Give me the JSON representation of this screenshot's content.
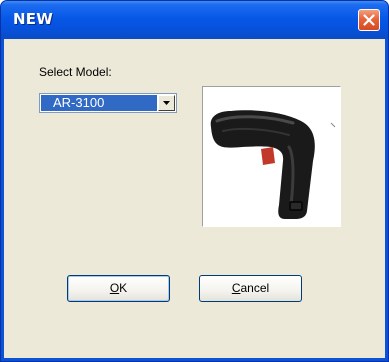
{
  "window": {
    "title": "NEW",
    "close_icon": "close-icon"
  },
  "form": {
    "select_label": "Select Model:",
    "model_value": "AR-3100",
    "dropdown_icon": "chevron-down-icon",
    "preview_icon": "barcode-scanner-image"
  },
  "buttons": {
    "ok_mnemonic": "O",
    "ok_rest": "K",
    "cancel_mnemonic": "C",
    "cancel_rest": "ancel"
  },
  "colors": {
    "titlebar": "#0758e6",
    "client": "#ece9d8",
    "selection": "#316ac5",
    "close": "#e8633b"
  }
}
